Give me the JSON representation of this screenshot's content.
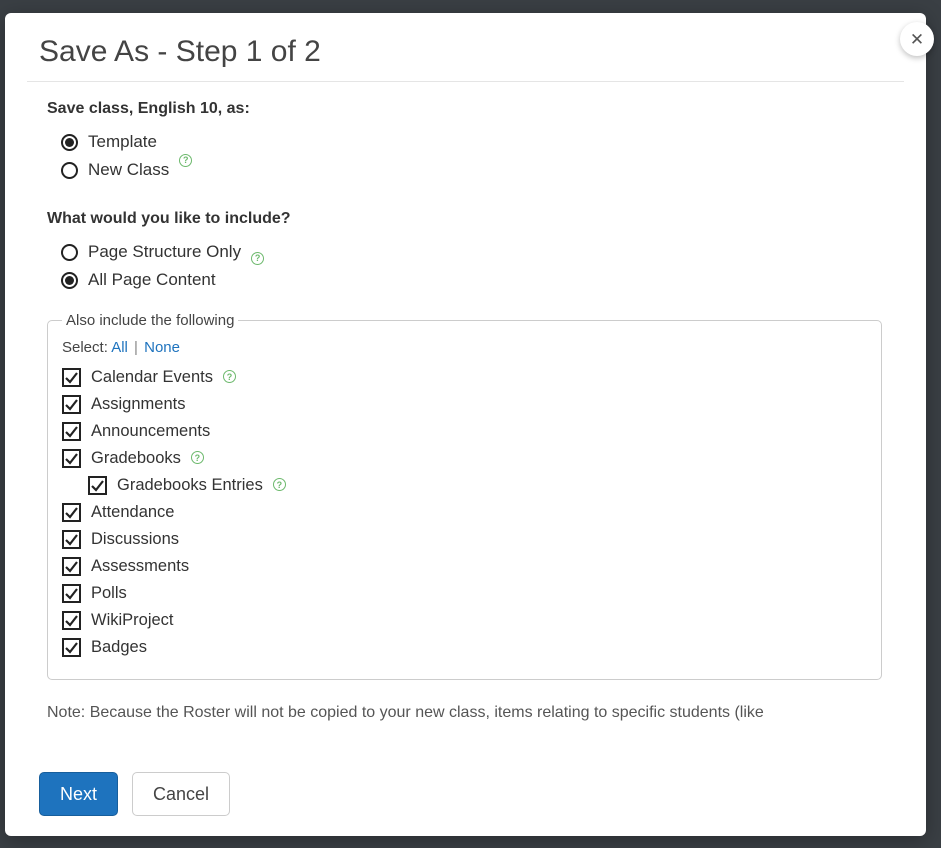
{
  "modal": {
    "title": "Save As - Step 1 of 2",
    "close_label": "✕"
  },
  "save_as": {
    "prompt": "Save class, English 10, as:",
    "options": {
      "template": "Template",
      "new_class": "New Class"
    }
  },
  "include": {
    "prompt": "What would you like to include?",
    "options": {
      "structure_only": "Page Structure Only",
      "all_content": "All Page Content"
    }
  },
  "also_include": {
    "legend": "Also include the following",
    "select_label": "Select:",
    "select_all": "All",
    "select_none": "None",
    "items": {
      "calendar_events": "Calendar Events",
      "assignments": "Assignments",
      "announcements": "Announcements",
      "gradebooks": "Gradebooks",
      "gradebooks_entries": "Gradebooks Entries",
      "attendance": "Attendance",
      "discussions": "Discussions",
      "assessments": "Assessments",
      "polls": "Polls",
      "wikiproject": "WikiProject",
      "badges": "Badges"
    }
  },
  "note": "Note: Because the Roster will not be copied to your new class, items relating to specific students (like",
  "footer": {
    "next": "Next",
    "cancel": "Cancel"
  },
  "help_glyph": "?"
}
